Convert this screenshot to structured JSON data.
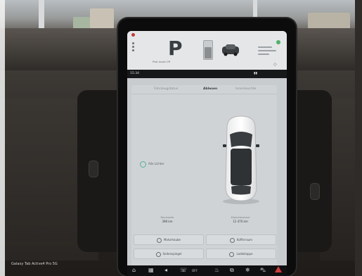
{
  "vehicle": {
    "gear": "P",
    "drive_status": "Pilot Assist Off",
    "time": "15:34"
  },
  "tabs": [
    {
      "label": "Fahrzeugstatus"
    },
    {
      "label": "Ablesen",
      "active": true
    },
    {
      "label": "Innenleuchte"
    }
  ],
  "lights": {
    "label": "Alle Lichter"
  },
  "stats": [
    {
      "label": "Reichweite",
      "value": "398 km"
    },
    {
      "label": "Kilometerstand",
      "value": "12 470 km"
    }
  ],
  "buttons": [
    {
      "label": "Motorhaube"
    },
    {
      "label": "Kofferraum"
    },
    {
      "label": "Seitenspiegel"
    },
    {
      "label": "Ladeklappe"
    }
  ],
  "dock": {
    "climate_status": "OFF"
  },
  "photo": {
    "caption": "Galaxy Tab Active4 Pro 5G"
  },
  "colors": {
    "screen_bg": "#d3d5d7",
    "accent_teal": "#4fb39b",
    "hazard_red": "#d43b3b",
    "status_green": "#4cb36a"
  },
  "icons": [
    "home-icon",
    "apps-icon",
    "volume-icon",
    "phone-icon",
    "climate-icon",
    "seat-heat-icon",
    "defrost-icon",
    "car-icon",
    "hazard-icon"
  ]
}
